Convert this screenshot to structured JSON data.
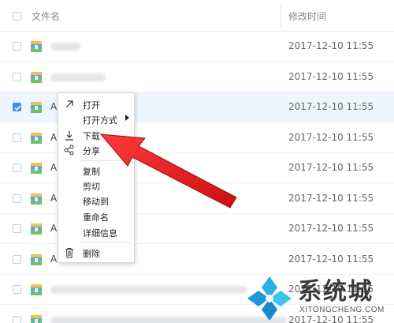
{
  "header": {
    "col_name": "文件名",
    "col_time": "修改时间"
  },
  "rows": [
    {
      "initial": "",
      "time": "2017-12-10 11:55",
      "selected": false
    },
    {
      "initial": "",
      "time": "2017-12-10 11:55",
      "selected": false
    },
    {
      "initial": "A",
      "time": "2017-12-10 11:55",
      "selected": true
    },
    {
      "initial": "A",
      "time": "2017-12-10 11:55",
      "selected": false
    },
    {
      "initial": "A",
      "time": "2017-12-10 11:55",
      "selected": false
    },
    {
      "initial": "A",
      "time": "2017-12-10 11:55",
      "selected": false
    },
    {
      "initial": "A",
      "time": "2017-12-10 11:55",
      "selected": false
    },
    {
      "initial": "A",
      "time": "2017-12-10 11:55",
      "selected": false
    },
    {
      "initial": "",
      "time": "2017-12-10 11:55",
      "selected": false
    },
    {
      "initial": "",
      "time": "2017-12-10 11:55",
      "selected": false
    }
  ],
  "context_menu": {
    "open": "打开",
    "open_with": "打开方式",
    "download": "下载",
    "share": "分享",
    "copy": "复制",
    "cut": "剪切",
    "move_to": "移动到",
    "rename": "重命名",
    "details": "详细信息",
    "delete": "删除"
  },
  "watermark": {
    "brand": "系统城",
    "domain": "XITONGCHENG.COM"
  },
  "colors": {
    "accent": "#3b8cf0",
    "selected_row": "#eef5fd",
    "arrow": "#e01b1b"
  },
  "icons": [
    "file-archive-icon",
    "open-arrow-icon",
    "download-icon",
    "share-icon",
    "trash-icon",
    "checkmark-icon",
    "submenu-arrow-icon"
  ]
}
